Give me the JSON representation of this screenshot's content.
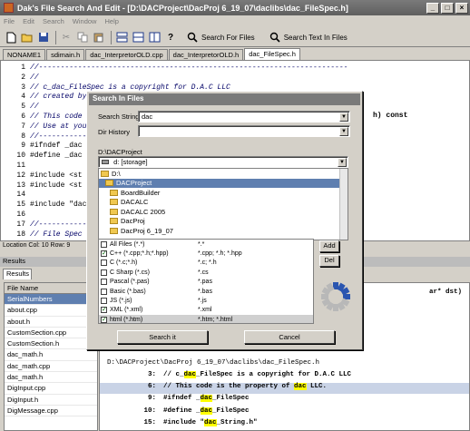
{
  "window": {
    "title": "Dak's File Search And Edit - [D:\\DACProject\\DacProj 6_19_07\\daclibs\\dac_FileSpec.h]"
  },
  "menu": [
    "File",
    "Edit",
    "Search",
    "Window",
    "Help"
  ],
  "toolbar": {
    "search_files": "Search For Files",
    "search_text": "Search Text In Files"
  },
  "tabs": [
    "NONAME1",
    "sdimain.h",
    "dac_InterpretorOLD.cpp",
    "dac_InterpretorOLD.h",
    "dac_FileSpec.h"
  ],
  "editor": {
    "lines": [
      {
        "n": "1",
        "t": "//-----------------------------------------------------------------------"
      },
      {
        "n": "2",
        "t": "//"
      },
      {
        "n": "3",
        "t": "// c_dac_FileSpec is a copyright for D.A.C LLC"
      },
      {
        "n": "4",
        "t": "// created by"
      },
      {
        "n": "5",
        "t": "//"
      },
      {
        "n": "6",
        "t": "// This code"
      },
      {
        "n": "7",
        "t": "// Use at you"
      },
      {
        "n": "8",
        "t": "//-----------"
      },
      {
        "n": "9",
        "t": "#ifndef _dac"
      },
      {
        "n": "10",
        "t": "#define _dac"
      },
      {
        "n": "11",
        "t": ""
      },
      {
        "n": "12",
        "t": "#include <st"
      },
      {
        "n": "13",
        "t": "#include <st"
      },
      {
        "n": "14",
        "t": ""
      },
      {
        "n": "15",
        "t": "#include \"dac"
      },
      {
        "n": "16",
        "t": ""
      },
      {
        "n": "17",
        "t": "//-----------"
      },
      {
        "n": "18",
        "t": "// File Spec"
      }
    ],
    "right_frag_1": "h) const",
    "right_frag_2": "ar* dst)"
  },
  "status": {
    "location": "Location Col: 10 Row: 9"
  },
  "results": {
    "title": "Results",
    "tab": "Add",
    "file_header": "File Name",
    "files": [
      "SerialNumbers",
      "about.cpp",
      "about.h",
      "CustomSection.cpp",
      "CustomSection.h",
      "dac_math.h",
      "dac_math.cpp",
      "dac_math.h",
      "DigInput.cpp",
      "DigInput.h",
      "DigMessage.cpp"
    ],
    "selected_file": 0,
    "path": "D:\\DACProject\\DacProj 6_19_07\\daclibs\\dac_FileSpec.h",
    "matches": [
      {
        "n": "3:",
        "pre": "// c_",
        "hit": "dac",
        "post": "_FileSpec is a copyright for D.A.C LLC"
      },
      {
        "n": "6:",
        "pre": "// This code is the property of ",
        "hit": "dac",
        "post": " LLC."
      },
      {
        "n": "9:",
        "pre": "#ifndef _",
        "hit": "dac",
        "post": "_FileSpec"
      },
      {
        "n": "10:",
        "pre": "#define _",
        "hit": "dac",
        "post": "_FileSpec"
      },
      {
        "n": "15:",
        "pre": "#include \"",
        "hit": "dac",
        "post": "_String.h\""
      }
    ]
  },
  "dialog": {
    "title": "Search In Files",
    "search_label": "Search String",
    "search_value": "dac",
    "dir_label": "Dir History",
    "dir_value": "",
    "current_dir": "D:\\DACProject",
    "drive": "d: [storage]",
    "folders": [
      {
        "name": "D:\\",
        "indent": 0
      },
      {
        "name": "DACProject",
        "indent": 1,
        "selected": true
      },
      {
        "name": "BoardBuilder",
        "indent": 2
      },
      {
        "name": "DACALC",
        "indent": 2
      },
      {
        "name": "DACALC 2005",
        "indent": 2
      },
      {
        "name": "DacProj",
        "indent": 2
      },
      {
        "name": "DacProj 6_19_07",
        "indent": 2
      }
    ],
    "types": [
      {
        "name": "All Files (*.*)",
        "ext": "*.*",
        "checked": false
      },
      {
        "name": "C++ (*.cpp;*.h;*.hpp)",
        "ext": "*.cpp; *.h; *.hpp",
        "checked": true
      },
      {
        "name": "C (*.c;*.h)",
        "ext": "*.c; *.h",
        "checked": false
      },
      {
        "name": "C Sharp (*.cs)",
        "ext": "*.cs",
        "checked": false
      },
      {
        "name": "Pascal (*.pas)",
        "ext": "*.pas",
        "checked": false
      },
      {
        "name": "Basic (*.bas)",
        "ext": "*.bas",
        "checked": false
      },
      {
        "name": "JS (*.js)",
        "ext": "*.js",
        "checked": false
      },
      {
        "name": "XML (*.xml)",
        "ext": "*.xml",
        "checked": true
      },
      {
        "name": "html (*.htm)",
        "ext": "*.htm; *.html",
        "checked": true,
        "selected": true
      }
    ],
    "add_label": "Add",
    "del_label": "Del",
    "search_button": "Search it",
    "cancel_button": "Cancel"
  }
}
